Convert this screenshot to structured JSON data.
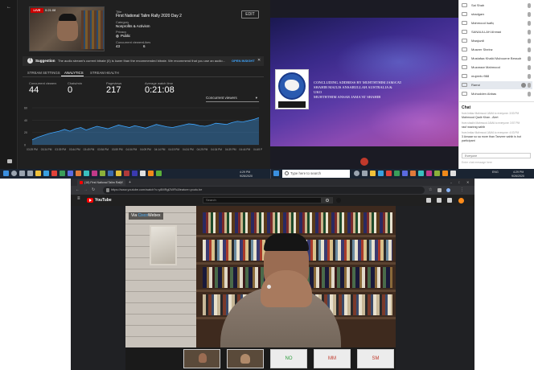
{
  "studio": {
    "live_badge": "LIVE",
    "live_time": "0:21:08",
    "title_label": "Title",
    "title": "First National Talim Rally 2020 Day 2",
    "category_label": "Category",
    "category": "Nonprofits & Activism",
    "privacy_label": "Privacy",
    "privacy": "Public",
    "concurrent_label": "Concurrent viewers",
    "concurrent_value": "43",
    "likes_label": "Likes",
    "likes_value": "6",
    "edit_button": "EDIT",
    "suggestion_label": "Suggestion",
    "suggestion_text": "The audio stream's current bitrate (0) is lower than the recommended bitrate. We recommend that you use an audio...",
    "suggestion_link": "OPEN INSIGHT",
    "tabs": [
      "STREAM SETTINGS",
      "ANALYTICS",
      "STREAM HEALTH"
    ],
    "stats": [
      {
        "label": "Concurrent viewers",
        "value": "44"
      },
      {
        "label": "Chats/min",
        "value": "0"
      },
      {
        "label": "Pageviews",
        "value": "217"
      },
      {
        "label": "Average watch time",
        "value": "0:21:08"
      }
    ],
    "dropdown": "Concurrent viewers",
    "chart_data": {
      "type": "area",
      "y_ticks": [
        "60",
        "40",
        "20",
        "0"
      ],
      "ylim": [
        0,
        60
      ],
      "x_ticks": [
        "03:29 PM",
        "03:34 PM",
        "03:39 PM",
        "03:44 PM",
        "03:49 PM",
        "03:54 PM",
        "03:59 PM",
        "04:04 PM",
        "04:09 PM",
        "04:14 PM",
        "04:19 PM",
        "04:24 PM",
        "04:29 PM",
        "04:34 PM",
        "04:39 PM",
        "04:44 PM",
        "04:49 PM"
      ],
      "values": [
        8,
        12,
        15,
        18,
        20,
        22,
        25,
        22,
        26,
        28,
        24,
        27,
        30,
        28,
        26,
        29,
        32,
        30,
        28,
        31,
        29,
        27,
        30,
        33,
        31,
        29,
        28,
        30,
        32,
        34,
        33,
        31,
        30,
        32,
        35,
        34,
        33,
        36,
        38,
        37,
        39,
        41,
        44
      ]
    }
  },
  "presentation": {
    "line1": "CONCLUDING ADDRESS BY MUHTHTHIM JAMA'AT",
    "line2": "SHAHIB MAJLIS ANSARULLAH AUSTRALIA &",
    "line3": "UKO",
    "line4": "MUHTHTHIM ANSAR JAMA'AT SHAHIB"
  },
  "participants": [
    {
      "initials": "SS",
      "name": "Sai Shah"
    },
    {
      "initials": "SH",
      "name": "shadgars"
    },
    {
      "initials": "MN",
      "name": "Mahmood Isafiq"
    },
    {
      "initials": "SA",
      "name": "SANAULLAH Ahmad"
    },
    {
      "initials": "MB",
      "name": "Maajuzdi"
    },
    {
      "initials": "MS",
      "name": "Museer Sheinz"
    },
    {
      "initials": "MK",
      "name": "Mustafaa Khalid Mubourne Bessub"
    },
    {
      "initials": "MM",
      "name": "Muzaraar Mahmood"
    },
    {
      "initials": "MU",
      "name": "mujeeb.r988"
    },
    {
      "initials": "RM",
      "name": "Ramzi"
    },
    {
      "initials": "MA",
      "name": "Mohudden Abbas"
    }
  ],
  "chat": {
    "title": "Chat",
    "messages": [
      {
        "meta": "from Imtiaz Mahmood JAMA to everyone: 3:53 PM",
        "text": "Mahmood Qadir Khan - Alert"
      },
      {
        "meta": "from shadin Mahmood JAMA to everyone: 3:57 PM",
        "text": "rauf wazirag sahib"
      },
      {
        "meta": "from Imtiaz Mahmood JAMA to everyone: 4:03 PM",
        "text": "3 Ansaar so sa more than Tanveer sahib is but participant"
      }
    ],
    "send_to": "Everyone",
    "input_placeholder": "Enter chat message here"
  },
  "taskbar": {
    "search_placeholder": "Type here to search",
    "time_left": "4:29 PM",
    "date_left": "9/26/2020",
    "lang": "ENG",
    "time_right": "4:29 PM",
    "date_right": "9/26/2020"
  },
  "browser": {
    "tab_title": "(18) First National Talim Rally 20",
    "url": "https://www.youtube.com/watch?v=y8MRgl2WFk&feature=youtu.be",
    "yt_logo": "YouTube",
    "search_placeholder": "Search",
    "via_prefix": "Via",
    "via_cisco": "Cisco",
    "via_webex": "Webex",
    "tiles": [
      "NO",
      "MM",
      "SM"
    ]
  },
  "colors": {
    "youtube_red": "#ff0000",
    "studio_bg": "#202020",
    "chart_line": "#3ea6ff",
    "taskbar": "#1a2432"
  }
}
